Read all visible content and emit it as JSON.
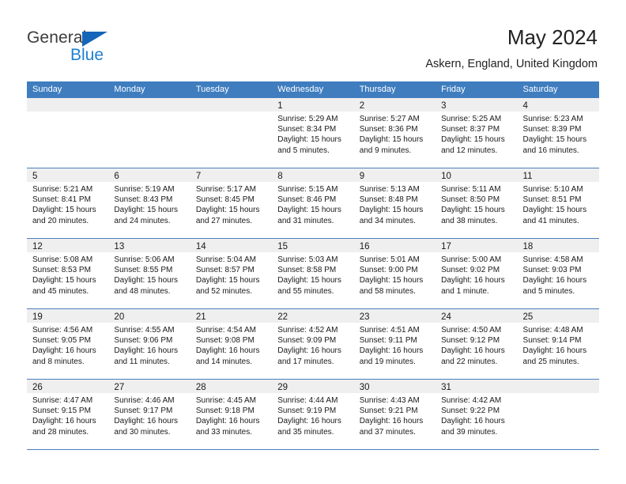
{
  "brand": {
    "name_top": "General",
    "name_bottom": "Blue",
    "accent_color": "#1f7fd0",
    "triangle_color": "#1565b8"
  },
  "header": {
    "title": "May 2024",
    "subtitle": "Askern, England, United Kingdom"
  },
  "theme": {
    "header_row_bg": "#3f7dbf",
    "daynum_band_bg": "#efefef",
    "week_divider": "#4a7fbc",
    "text": "#1a1a1a"
  },
  "weekdays": [
    "Sunday",
    "Monday",
    "Tuesday",
    "Wednesday",
    "Thursday",
    "Friday",
    "Saturday"
  ],
  "weeks": [
    [
      {
        "day": "",
        "sunrise": "",
        "sunset": "",
        "daylight": ""
      },
      {
        "day": "",
        "sunrise": "",
        "sunset": "",
        "daylight": ""
      },
      {
        "day": "",
        "sunrise": "",
        "sunset": "",
        "daylight": ""
      },
      {
        "day": "1",
        "sunrise": "Sunrise: 5:29 AM",
        "sunset": "Sunset: 8:34 PM",
        "daylight": "Daylight: 15 hours and 5 minutes."
      },
      {
        "day": "2",
        "sunrise": "Sunrise: 5:27 AM",
        "sunset": "Sunset: 8:36 PM",
        "daylight": "Daylight: 15 hours and 9 minutes."
      },
      {
        "day": "3",
        "sunrise": "Sunrise: 5:25 AM",
        "sunset": "Sunset: 8:37 PM",
        "daylight": "Daylight: 15 hours and 12 minutes."
      },
      {
        "day": "4",
        "sunrise": "Sunrise: 5:23 AM",
        "sunset": "Sunset: 8:39 PM",
        "daylight": "Daylight: 15 hours and 16 minutes."
      }
    ],
    [
      {
        "day": "5",
        "sunrise": "Sunrise: 5:21 AM",
        "sunset": "Sunset: 8:41 PM",
        "daylight": "Daylight: 15 hours and 20 minutes."
      },
      {
        "day": "6",
        "sunrise": "Sunrise: 5:19 AM",
        "sunset": "Sunset: 8:43 PM",
        "daylight": "Daylight: 15 hours and 24 minutes."
      },
      {
        "day": "7",
        "sunrise": "Sunrise: 5:17 AM",
        "sunset": "Sunset: 8:45 PM",
        "daylight": "Daylight: 15 hours and 27 minutes."
      },
      {
        "day": "8",
        "sunrise": "Sunrise: 5:15 AM",
        "sunset": "Sunset: 8:46 PM",
        "daylight": "Daylight: 15 hours and 31 minutes."
      },
      {
        "day": "9",
        "sunrise": "Sunrise: 5:13 AM",
        "sunset": "Sunset: 8:48 PM",
        "daylight": "Daylight: 15 hours and 34 minutes."
      },
      {
        "day": "10",
        "sunrise": "Sunrise: 5:11 AM",
        "sunset": "Sunset: 8:50 PM",
        "daylight": "Daylight: 15 hours and 38 minutes."
      },
      {
        "day": "11",
        "sunrise": "Sunrise: 5:10 AM",
        "sunset": "Sunset: 8:51 PM",
        "daylight": "Daylight: 15 hours and 41 minutes."
      }
    ],
    [
      {
        "day": "12",
        "sunrise": "Sunrise: 5:08 AM",
        "sunset": "Sunset: 8:53 PM",
        "daylight": "Daylight: 15 hours and 45 minutes."
      },
      {
        "day": "13",
        "sunrise": "Sunrise: 5:06 AM",
        "sunset": "Sunset: 8:55 PM",
        "daylight": "Daylight: 15 hours and 48 minutes."
      },
      {
        "day": "14",
        "sunrise": "Sunrise: 5:04 AM",
        "sunset": "Sunset: 8:57 PM",
        "daylight": "Daylight: 15 hours and 52 minutes."
      },
      {
        "day": "15",
        "sunrise": "Sunrise: 5:03 AM",
        "sunset": "Sunset: 8:58 PM",
        "daylight": "Daylight: 15 hours and 55 minutes."
      },
      {
        "day": "16",
        "sunrise": "Sunrise: 5:01 AM",
        "sunset": "Sunset: 9:00 PM",
        "daylight": "Daylight: 15 hours and 58 minutes."
      },
      {
        "day": "17",
        "sunrise": "Sunrise: 5:00 AM",
        "sunset": "Sunset: 9:02 PM",
        "daylight": "Daylight: 16 hours and 1 minute."
      },
      {
        "day": "18",
        "sunrise": "Sunrise: 4:58 AM",
        "sunset": "Sunset: 9:03 PM",
        "daylight": "Daylight: 16 hours and 5 minutes."
      }
    ],
    [
      {
        "day": "19",
        "sunrise": "Sunrise: 4:56 AM",
        "sunset": "Sunset: 9:05 PM",
        "daylight": "Daylight: 16 hours and 8 minutes."
      },
      {
        "day": "20",
        "sunrise": "Sunrise: 4:55 AM",
        "sunset": "Sunset: 9:06 PM",
        "daylight": "Daylight: 16 hours and 11 minutes."
      },
      {
        "day": "21",
        "sunrise": "Sunrise: 4:54 AM",
        "sunset": "Sunset: 9:08 PM",
        "daylight": "Daylight: 16 hours and 14 minutes."
      },
      {
        "day": "22",
        "sunrise": "Sunrise: 4:52 AM",
        "sunset": "Sunset: 9:09 PM",
        "daylight": "Daylight: 16 hours and 17 minutes."
      },
      {
        "day": "23",
        "sunrise": "Sunrise: 4:51 AM",
        "sunset": "Sunset: 9:11 PM",
        "daylight": "Daylight: 16 hours and 19 minutes."
      },
      {
        "day": "24",
        "sunrise": "Sunrise: 4:50 AM",
        "sunset": "Sunset: 9:12 PM",
        "daylight": "Daylight: 16 hours and 22 minutes."
      },
      {
        "day": "25",
        "sunrise": "Sunrise: 4:48 AM",
        "sunset": "Sunset: 9:14 PM",
        "daylight": "Daylight: 16 hours and 25 minutes."
      }
    ],
    [
      {
        "day": "26",
        "sunrise": "Sunrise: 4:47 AM",
        "sunset": "Sunset: 9:15 PM",
        "daylight": "Daylight: 16 hours and 28 minutes."
      },
      {
        "day": "27",
        "sunrise": "Sunrise: 4:46 AM",
        "sunset": "Sunset: 9:17 PM",
        "daylight": "Daylight: 16 hours and 30 minutes."
      },
      {
        "day": "28",
        "sunrise": "Sunrise: 4:45 AM",
        "sunset": "Sunset: 9:18 PM",
        "daylight": "Daylight: 16 hours and 33 minutes."
      },
      {
        "day": "29",
        "sunrise": "Sunrise: 4:44 AM",
        "sunset": "Sunset: 9:19 PM",
        "daylight": "Daylight: 16 hours and 35 minutes."
      },
      {
        "day": "30",
        "sunrise": "Sunrise: 4:43 AM",
        "sunset": "Sunset: 9:21 PM",
        "daylight": "Daylight: 16 hours and 37 minutes."
      },
      {
        "day": "31",
        "sunrise": "Sunrise: 4:42 AM",
        "sunset": "Sunset: 9:22 PM",
        "daylight": "Daylight: 16 hours and 39 minutes."
      },
      {
        "day": "",
        "sunrise": "",
        "sunset": "",
        "daylight": ""
      }
    ]
  ]
}
